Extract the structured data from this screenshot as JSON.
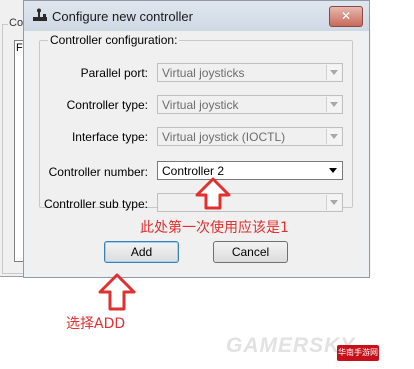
{
  "dialog": {
    "title": "Configure new controller",
    "group_label": "Controller configuration:",
    "rows": [
      {
        "label": "Parallel port:",
        "value": "Virtual joysticks",
        "enabled": false
      },
      {
        "label": "Controller type:",
        "value": "Virtual joystick",
        "enabled": false
      },
      {
        "label": "Interface type:",
        "value": "Virtual joystick (IOCTL)",
        "enabled": false
      },
      {
        "label": "Controller number:",
        "value": "Controller 2",
        "enabled": true
      },
      {
        "label": "Controller sub type:",
        "value": "",
        "enabled": false
      }
    ],
    "buttons": {
      "add": "Add",
      "cancel": "Cancel"
    }
  },
  "background_window": {
    "group_label": "Co",
    "inner_label": "F"
  },
  "annotations": {
    "note_controller_number": "此处第一次使用应该是1",
    "note_add": "选择ADD"
  },
  "colors": {
    "annotation": "#e03030"
  },
  "icons": {
    "title_icon": "joystick-icon",
    "close": "close-icon",
    "dropdown": "chevron-down-icon"
  },
  "watermark": "GAMERSKY",
  "logo_text": "华南手游网"
}
